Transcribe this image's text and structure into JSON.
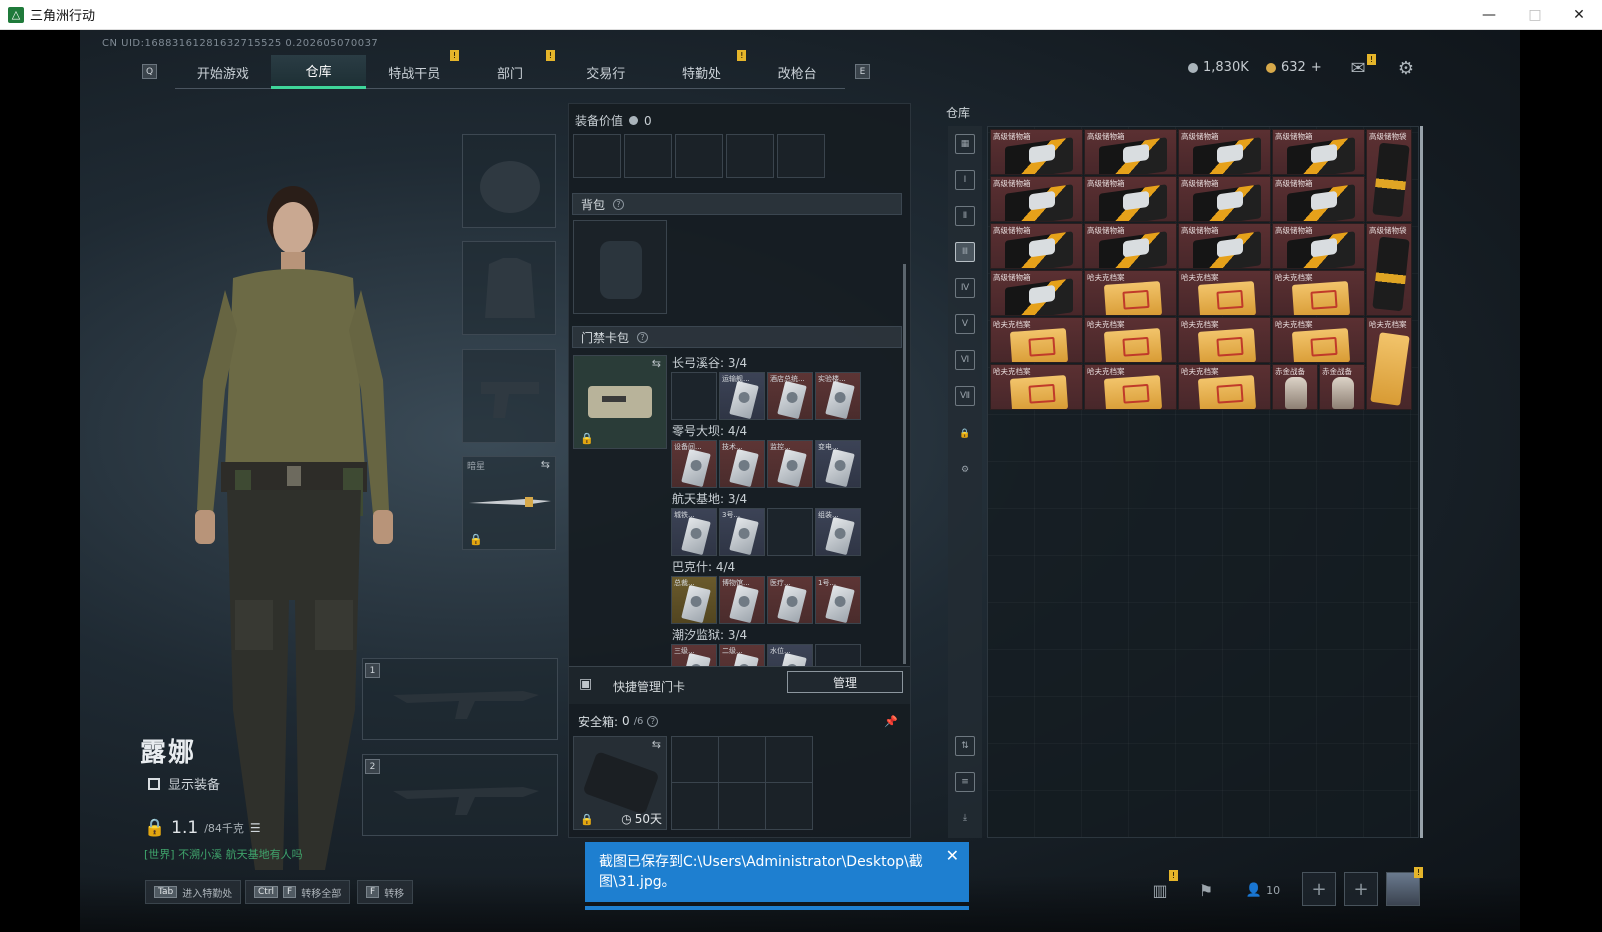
{
  "window": {
    "title": "三角洲行动",
    "minimize": "—",
    "maximize": "□",
    "close": "✕"
  },
  "uid": "CN UID:16883161281632715525 0.202605070037",
  "nav": {
    "left_key": "Q",
    "right_key": "E",
    "items": [
      {
        "label": "开始游戏",
        "badge": ""
      },
      {
        "label": "仓库",
        "badge": ""
      },
      {
        "label": "特战干员",
        "badge": "!"
      },
      {
        "label": "部门",
        "badge": "!"
      },
      {
        "label": "交易行",
        "badge": ""
      },
      {
        "label": "特勤处",
        "badge": "!"
      },
      {
        "label": "改枪台",
        "badge": ""
      }
    ]
  },
  "currency": {
    "silver": "1,830K",
    "gold": "632",
    "plus": "+"
  },
  "character": {
    "name": "露娜",
    "show_equipment": "显示装备",
    "weight_value": "1.1",
    "weight_unit": "/84千克",
    "world_chat": "[世界] 不溯小溪 航天基地有人吗"
  },
  "equip": {
    "melee_label": "暗星",
    "weapon_slot_1": "1",
    "weapon_slot_2": "2"
  },
  "mid": {
    "equip_value_label": "装备价值",
    "equip_value": "0",
    "backpack_label": "背包",
    "keycard_label": "门禁卡包",
    "groups": [
      {
        "label": "长弓溪谷: 3/4",
        "cards": [
          {
            "name": "",
            "style": "empty"
          },
          {
            "name": "运输舰...",
            "style": "blue"
          },
          {
            "name": "酒店总统...",
            "style": "red"
          },
          {
            "name": "实验楼...",
            "style": "red"
          }
        ]
      },
      {
        "label": "零号大坝: 4/4",
        "cards": [
          {
            "name": "设备间...",
            "style": "red"
          },
          {
            "name": "技术...",
            "style": "red"
          },
          {
            "name": "监控...",
            "style": "red"
          },
          {
            "name": "变电...",
            "style": "blue"
          }
        ]
      },
      {
        "label": "航天基地: 3/4",
        "cards": [
          {
            "name": "城铁...",
            "style": "blue"
          },
          {
            "name": "3号...",
            "style": "blue"
          },
          {
            "name": "",
            "style": "empty"
          },
          {
            "name": "组装...",
            "style": "blue"
          }
        ]
      },
      {
        "label": "巴克什: 4/4",
        "cards": [
          {
            "name": "总裁...",
            "style": "gold"
          },
          {
            "name": "博物馆...",
            "style": "red"
          },
          {
            "name": "医疗...",
            "style": "red"
          },
          {
            "name": "1号...",
            "style": "red"
          }
        ]
      },
      {
        "label": "潮汐监狱: 3/4",
        "cards": [
          {
            "name": "三级...",
            "style": "red"
          },
          {
            "name": "二级...",
            "style": "red"
          },
          {
            "name": "水位...",
            "style": "blue"
          },
          {
            "name": "",
            "style": "empty"
          }
        ]
      }
    ],
    "quick_manage_label": "快捷管理门卡",
    "manage_button": "管理",
    "safebox_label": "安全箱:",
    "safebox_value": "0",
    "safebox_max": "/6",
    "safebox_time": "50天"
  },
  "warehouse": {
    "title": "仓库",
    "item_names": {
      "box": "高级储物箱",
      "bag": "高级储物袋",
      "folder": "哈夫克档案",
      "figure": "赤金战备"
    }
  },
  "bottom": {
    "hint1_key": "Tab",
    "hint1_text": "进入特勤处",
    "hint2_key1": "Ctrl",
    "hint2_key2": "F",
    "hint2_text": "转移全部",
    "hint3_key": "F",
    "hint3_text": "转移",
    "friends_count": "10"
  },
  "toast": {
    "message": "截图已保存到C:\\Users\\Administrator\\Desktop\\截图\\31.jpg。",
    "close": "✕"
  },
  "colors": {
    "accent": "#3fd69a",
    "badge": "#e5b52a",
    "toast": "#1e7fd0",
    "item_bg": "#5b3032"
  }
}
